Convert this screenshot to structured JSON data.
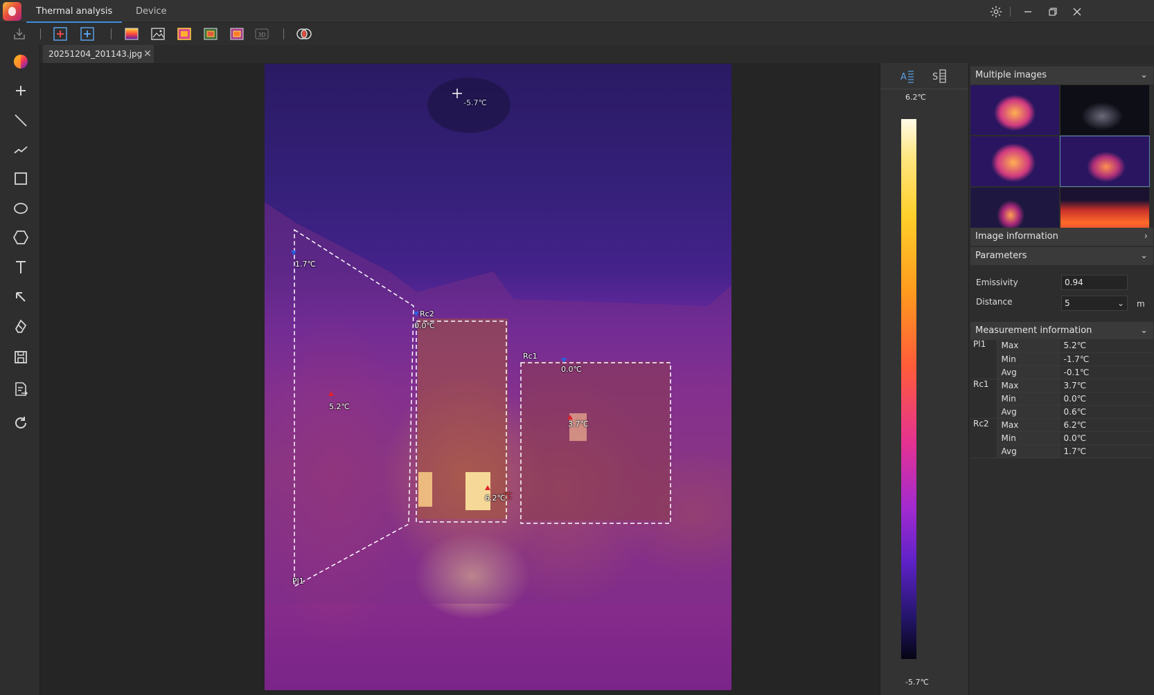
{
  "titlebar": {
    "tabs": [
      {
        "label": "Thermal analysis",
        "active": true
      },
      {
        "label": "Device",
        "active": false
      }
    ]
  },
  "file_tab": {
    "name": "20251204_201143.jpg"
  },
  "colors": {
    "accent": "#3d8fe0",
    "max_marker": "#e0202a",
    "min_marker": "#2a5fe0"
  },
  "image": {
    "cursor_temp": "-5.7℃",
    "markers": {
      "pl1_min": "1.7℃",
      "pl1_max": "5.2℃",
      "rc2_min": "0.0℃",
      "rc2_max": "6.2℃",
      "rc1_min": "0.0℃",
      "rc1_max": "3.7℃"
    },
    "regions": {
      "pl1": "Pl1",
      "rc1": "Rc1",
      "rc2": "Rc2"
    },
    "overlap_text": "℃"
  },
  "colorbar": {
    "max": "6.2℃",
    "min": "-5.7℃"
  },
  "rightpanel": {
    "multiple_images": "Multiple images",
    "image_information": "Image information",
    "parameters": "Parameters",
    "emissivity_label": "Emissivity",
    "emissivity_value": "0.94",
    "distance_label": "Distance",
    "distance_value": "5",
    "distance_unit": "m",
    "measurement_information": "Measurement information",
    "measurements": [
      {
        "region": "Pl1",
        "max": "5.2℃",
        "min": "-1.7℃",
        "avg": "-0.1℃"
      },
      {
        "region": "Rc1",
        "max": "3.7℃",
        "min": "0.0℃",
        "avg": "0.6℃"
      },
      {
        "region": "Rc2",
        "max": "6.2℃",
        "min": "0.0℃",
        "avg": "1.7℃"
      }
    ],
    "row_labels": {
      "max": "Max",
      "min": "Min",
      "avg": "Avg"
    }
  }
}
